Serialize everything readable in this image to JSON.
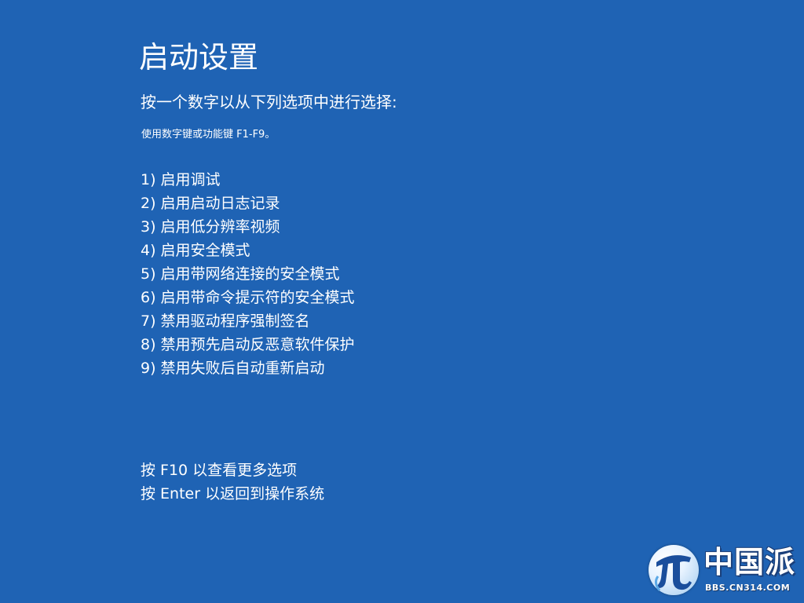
{
  "screen": {
    "title": "启动设置",
    "prompt": "按一个数字以从下列选项中进行选择:",
    "hint": "使用数字键或功能键 F1-F9。",
    "options": [
      "1) 启用调试",
      "2) 启用启动日志记录",
      "3) 启用低分辨率视频",
      "4) 启用安全模式",
      "5) 启用带网络连接的安全模式",
      "6) 启用带命令提示符的安全模式",
      "7) 禁用驱动程序强制签名",
      "8) 禁用预先启动反恶意软件保护",
      "9) 禁用失败后自动重新启动"
    ],
    "footer": {
      "more_options": "按 F10 以查看更多选项",
      "return": "按 Enter 以返回到操作系统"
    }
  },
  "watermark": {
    "logo_text": "中国派",
    "url": "BBS.CN314.COM",
    "icon": "pi-logo-icon"
  },
  "colors": {
    "background": "#1f63b4",
    "text": "#ffffff"
  }
}
